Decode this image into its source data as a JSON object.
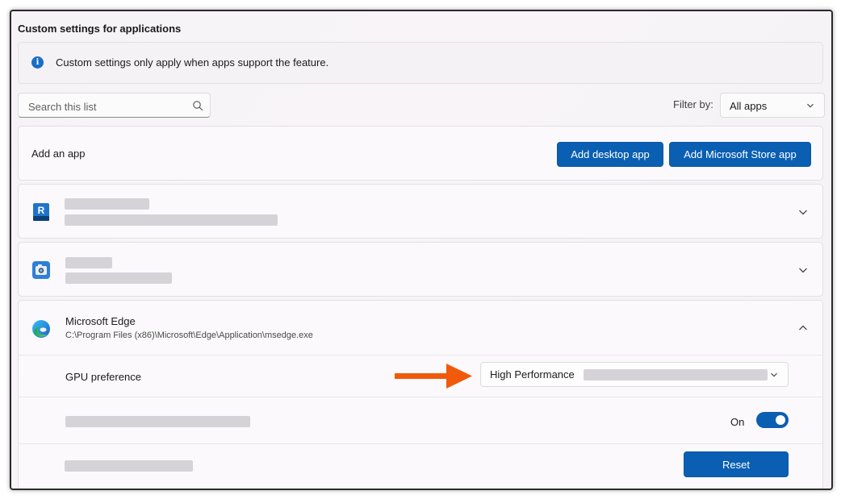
{
  "section": {
    "title": "Custom settings for applications"
  },
  "info": {
    "icon": "info-icon",
    "text": "Custom settings only apply when apps support the feature."
  },
  "search": {
    "placeholder": "Search this list",
    "value": ""
  },
  "filter": {
    "label": "Filter by:",
    "selected": "All apps"
  },
  "add_app": {
    "label": "Add an app",
    "desktop_button": "Add desktop app",
    "store_button": "Add Microsoft Store app"
  },
  "apps": [
    {
      "icon": "revit-app-icon",
      "name_redacted": true,
      "expanded": false
    },
    {
      "icon": "camera-app-icon",
      "name_redacted": true,
      "expanded": false
    },
    {
      "icon": "edge-icon",
      "name": "Microsoft Edge",
      "path": "C:\\Program Files (x86)\\Microsoft\\Edge\\Application\\msedge.exe",
      "expanded": true,
      "gpu_preference": {
        "label": "GPU preference",
        "selected": "High Performance"
      },
      "toggle": {
        "state_label": "On",
        "checked": true
      },
      "reset_button": "Reset"
    }
  ],
  "annotation": {
    "arrow_color": "#f05a0a"
  },
  "colors": {
    "accent": "#0a5fb3",
    "info_icon": "#1a6fc4"
  }
}
